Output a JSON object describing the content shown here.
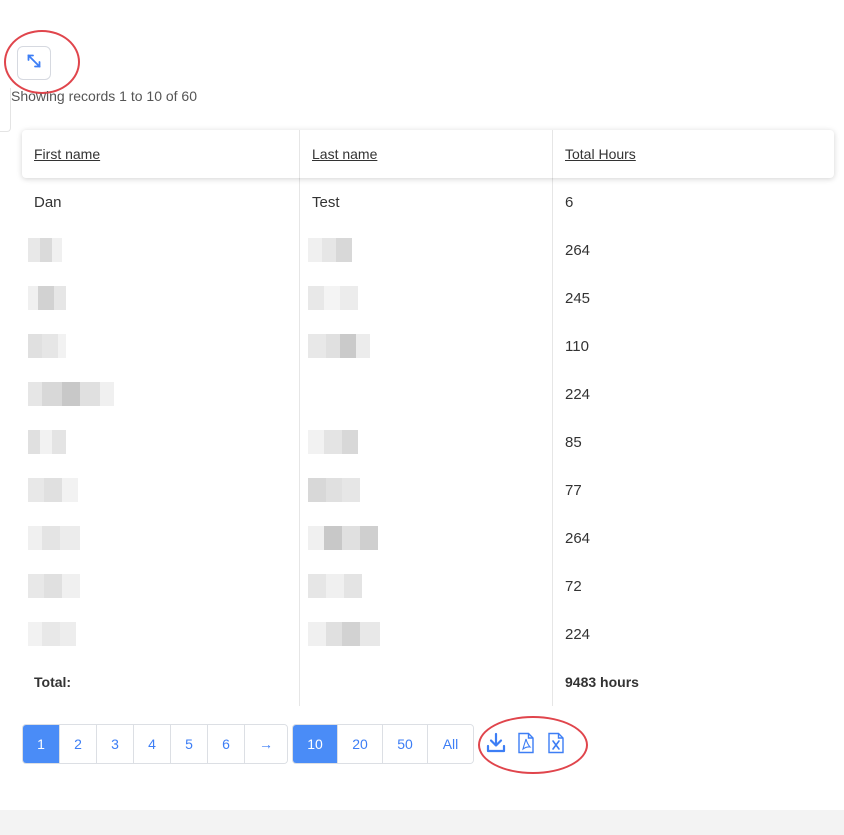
{
  "toolbar": {
    "expand_icon": "expand-arrows-icon"
  },
  "records_info": "Showing records 1 to 10 of 60",
  "table": {
    "headers": {
      "first_name": "First name",
      "last_name": "Last name",
      "total_hours": "Total Hours"
    },
    "rows": [
      {
        "first_name": "Dan",
        "last_name": "Test",
        "total_hours": "6"
      },
      {
        "first_name": "",
        "last_name": "",
        "total_hours": "264"
      },
      {
        "first_name": "",
        "last_name": "",
        "total_hours": "245"
      },
      {
        "first_name": "",
        "last_name": "",
        "total_hours": "110"
      },
      {
        "first_name": "",
        "last_name": "",
        "total_hours": "224"
      },
      {
        "first_name": "",
        "last_name": "",
        "total_hours": "85"
      },
      {
        "first_name": "",
        "last_name": "",
        "total_hours": "77"
      },
      {
        "first_name": "",
        "last_name": "",
        "total_hours": "264"
      },
      {
        "first_name": "",
        "last_name": "",
        "total_hours": "72"
      },
      {
        "first_name": "",
        "last_name": "",
        "total_hours": "224"
      }
    ],
    "total": {
      "label": "Total:",
      "value": "9483 hours"
    }
  },
  "pagination": {
    "pages": [
      "1",
      "2",
      "3",
      "4",
      "5",
      "6"
    ],
    "next": "→",
    "current_page": "1",
    "page_sizes": [
      "10",
      "20",
      "50",
      "All"
    ],
    "current_size": "10"
  },
  "export": {
    "icons": [
      "download-icon",
      "pdf-icon",
      "excel-icon"
    ]
  },
  "colors": {
    "accent": "#4a8cf7",
    "annotation": "#e0454c"
  }
}
